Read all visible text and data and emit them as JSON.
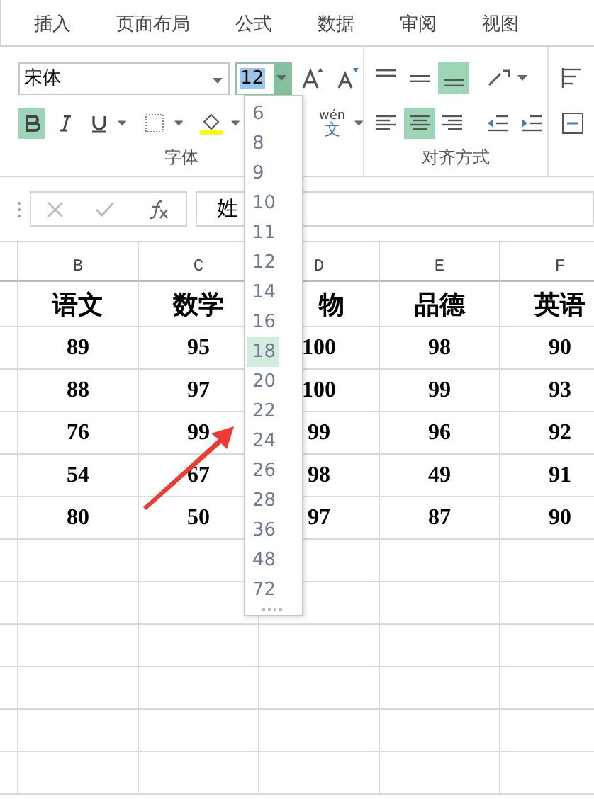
{
  "tabs": [
    {
      "label": "插入",
      "selected": false
    },
    {
      "label": "页面布局",
      "selected": false
    },
    {
      "label": "公式",
      "selected": false
    },
    {
      "label": "数据",
      "selected": false
    },
    {
      "label": "审阅",
      "selected": false
    },
    {
      "label": "视图",
      "selected": false
    }
  ],
  "font": {
    "name": "宋体",
    "size": "12",
    "bold": true,
    "italic": false,
    "underline": false,
    "group_label": "字体"
  },
  "alignment": {
    "vertical_buttons": [
      {
        "selected": false
      },
      {
        "selected": false
      },
      {
        "selected": true
      }
    ],
    "horizontal_buttons": [
      {
        "selected": false
      },
      {
        "selected": true
      },
      {
        "selected": false
      }
    ],
    "group_label": "对齐方式"
  },
  "phonetic": {
    "top": "wén",
    "bottom": "文"
  },
  "formula_bar": {
    "value": "姓"
  },
  "sheet": {
    "columns": [
      "B",
      "C",
      "D",
      "E",
      "F"
    ],
    "rows": [
      [
        "语文",
        "数学",
        "物",
        "品德",
        "英语"
      ],
      [
        "89",
        "95",
        "100",
        "98",
        "90"
      ],
      [
        "88",
        "97",
        "100",
        "99",
        "93"
      ],
      [
        "76",
        "99",
        "99",
        "96",
        "92"
      ],
      [
        "54",
        "67",
        "98",
        "49",
        "91"
      ],
      [
        "80",
        "50",
        "97",
        "87",
        "90"
      ]
    ]
  },
  "size_menu": [
    {
      "label": "6",
      "selected": false
    },
    {
      "label": "8",
      "selected": false
    },
    {
      "label": "9",
      "selected": false
    },
    {
      "label": "10",
      "selected": false
    },
    {
      "label": "11",
      "selected": false
    },
    {
      "label": "12",
      "selected": false
    },
    {
      "label": "14",
      "selected": false
    },
    {
      "label": "16",
      "selected": false
    },
    {
      "label": "18",
      "selected": true
    },
    {
      "label": "20",
      "selected": false
    },
    {
      "label": "22",
      "selected": false
    },
    {
      "label": "24",
      "selected": false
    },
    {
      "label": "26",
      "selected": false
    },
    {
      "label": "28",
      "selected": false
    },
    {
      "label": "36",
      "selected": false
    },
    {
      "label": "48",
      "selected": false
    },
    {
      "label": "72",
      "selected": false
    }
  ]
}
